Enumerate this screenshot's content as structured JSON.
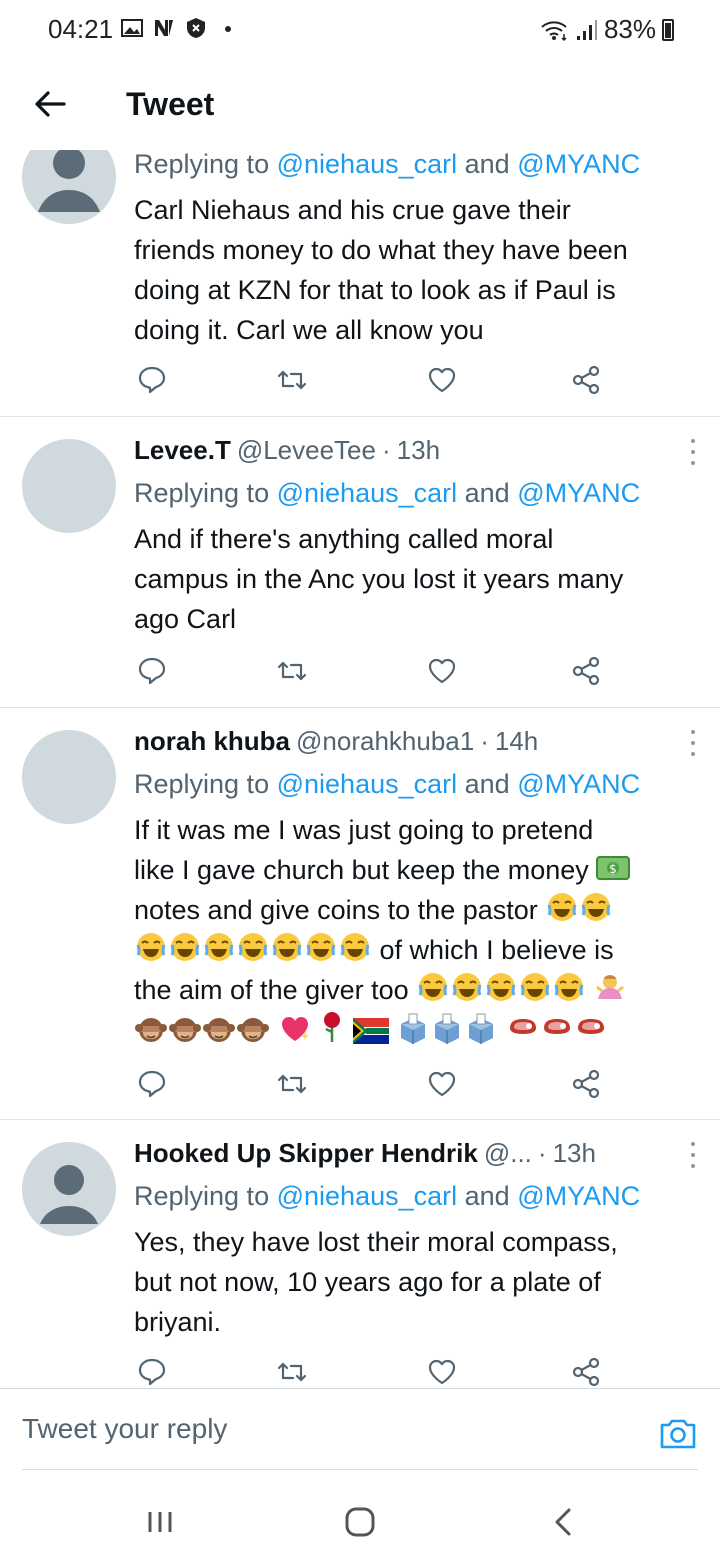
{
  "status_bar": {
    "time": "04:21",
    "battery": "83%"
  },
  "header": {
    "title": "Tweet"
  },
  "tweets": [
    {
      "name": "",
      "handle": "",
      "time": "",
      "replying_prefix": "Replying to",
      "mention1": "@niehaus_carl",
      "and": "and",
      "mention2": "@MYANC",
      "lines": [
        "Carl Niehaus and his crue gave their",
        "friends money to do what they have been",
        "doing at KZN for that to look as if Paul is",
        "doing it. Carl we all know you"
      ]
    },
    {
      "name": "Levee.T",
      "handle": "@LeveeTee",
      "time": "13h",
      "replying_prefix": "Replying to",
      "mention1": "@niehaus_carl",
      "and": "and",
      "mention2": "@MYANC",
      "lines": [
        "And if there's anything called moral",
        "campus in the Anc you lost it years many",
        "ago Carl"
      ]
    },
    {
      "name": "norah khuba",
      "handle": "@norahkhuba1",
      "time": "14h",
      "replying_prefix": "Replying to",
      "mention1": "@niehaus_carl",
      "and": "and",
      "mention2": "@MYANC",
      "line1": "If it was me I was just going to pretend",
      "line2": "like I gave church but keep the money",
      "line3": "notes and give coins to the pastor",
      "line4": "of which I believe is",
      "line5": "the aim of the giver too"
    },
    {
      "name": "Hooked Up Skipper Hendrik",
      "handle": "@...",
      "time": "13h",
      "replying_prefix": "Replying to",
      "mention1": "@niehaus_carl",
      "and": "and",
      "mention2": "@MYANC",
      "lines": [
        "Yes, they have lost their moral compass,",
        "but not now, 10 years ago for a plate of",
        "briyani."
      ]
    }
  ],
  "compose": {
    "placeholder": "Tweet your reply"
  },
  "icons": {
    "reply": "reply-icon",
    "retweet": "retweet-icon",
    "like": "heart-icon",
    "share": "share-icon",
    "camera": "camera-icon"
  },
  "colors": {
    "link": "#1d9bf0",
    "secondary_text": "#536471",
    "avatar_bg": "#cfd9de"
  }
}
